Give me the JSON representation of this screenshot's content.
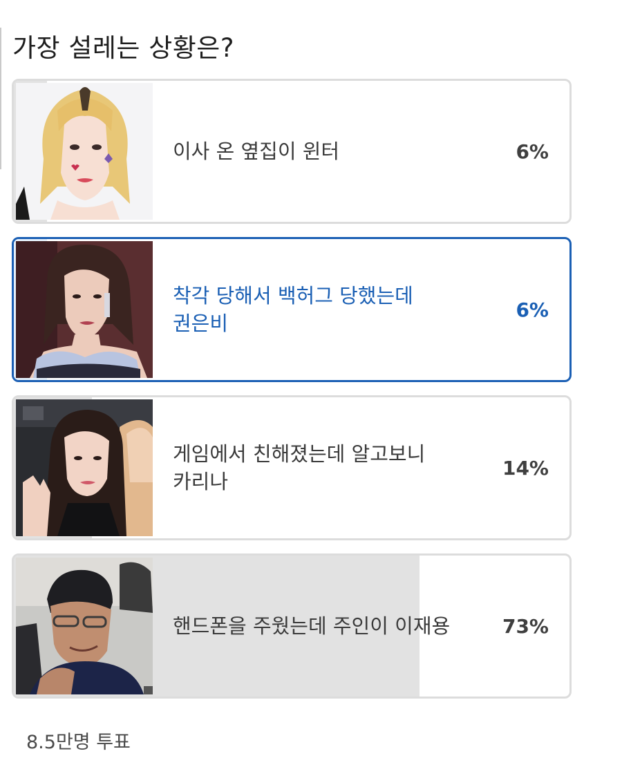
{
  "poll": {
    "title": "가장 설레는 상황은?",
    "options": [
      {
        "label": "이사 온 옆집이 윈터",
        "percent_text": "6%",
        "percent": 6,
        "selected": false,
        "image": "winter-photo"
      },
      {
        "label": "착각 당해서 백허그 당했는데 권은비",
        "percent_text": "6%",
        "percent": 6,
        "selected": true,
        "image": "kwon-eunbi-photo"
      },
      {
        "label": "게임에서 친해졌는데 알고보니 카리나",
        "percent_text": "14%",
        "percent": 14,
        "selected": false,
        "image": "karina-photo"
      },
      {
        "label": "핸드폰을 주웠는데 주인이 이재용",
        "percent_text": "73%",
        "percent": 73,
        "selected": false,
        "image": "lee-jaeyong-photo"
      }
    ],
    "vote_count": "8.5만명 투표"
  },
  "colors": {
    "selected_border": "#1a5fb4",
    "selected_text": "#1a5fb4",
    "default_border": "#dcdcdc",
    "result_fill": "#e2e2e2",
    "selected_fill": "#e6f0fb"
  }
}
